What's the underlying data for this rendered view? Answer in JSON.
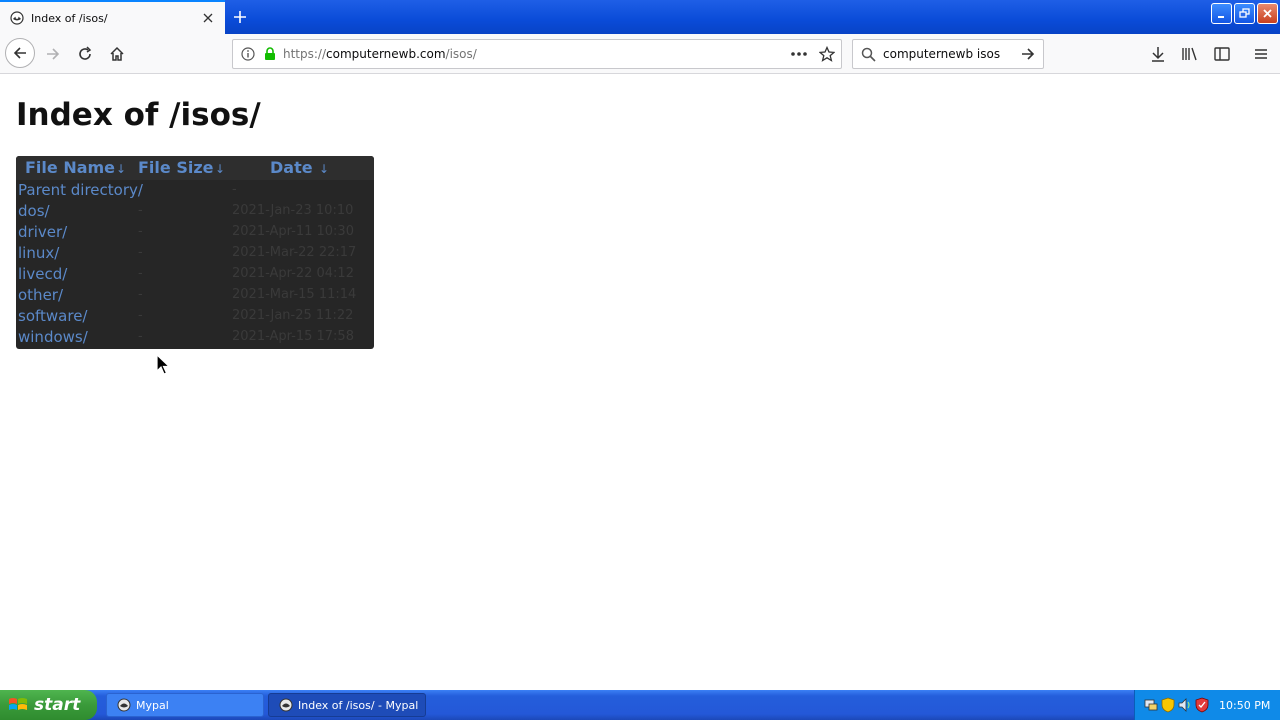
{
  "browser": {
    "tab": {
      "title": "Index of /isos/",
      "favicon": "mypal-icon"
    },
    "url": {
      "scheme": "https://",
      "host": "computernewb.com",
      "path": "/isos/"
    },
    "search": {
      "value": "computernewb isos"
    }
  },
  "page": {
    "title": "Index of /isos/",
    "columns": [
      {
        "label": "File Name",
        "sort": "↓"
      },
      {
        "label": "File Size",
        "sort": "↓"
      },
      {
        "label": "Date",
        "sort": "↓"
      }
    ],
    "rows": [
      {
        "name": "Parent directory/",
        "size": "",
        "date": "-"
      },
      {
        "name": "dos/",
        "size": "-",
        "date": "2021-Jan-23 10:10"
      },
      {
        "name": "driver/",
        "size": "-",
        "date": "2021-Apr-11 10:30"
      },
      {
        "name": "linux/",
        "size": "-",
        "date": "2021-Mar-22 22:17"
      },
      {
        "name": "livecd/",
        "size": "-",
        "date": "2021-Apr-22 04:12"
      },
      {
        "name": "other/",
        "size": "-",
        "date": "2021-Mar-15 11:14"
      },
      {
        "name": "software/",
        "size": "-",
        "date": "2021-Jan-25 11:22"
      },
      {
        "name": "windows/",
        "size": "-",
        "date": "2021-Apr-15 17:58"
      }
    ]
  },
  "taskbar": {
    "start_label": "start",
    "items": [
      {
        "label": "Mypal"
      },
      {
        "label": "Index of /isos/ - Mypal"
      }
    ],
    "clock": "10:50 PM"
  },
  "colors": {
    "link": "#5b89c9",
    "listing_bg": "#262626",
    "taskbar": "#245edb",
    "start": "#3a9a3a"
  }
}
